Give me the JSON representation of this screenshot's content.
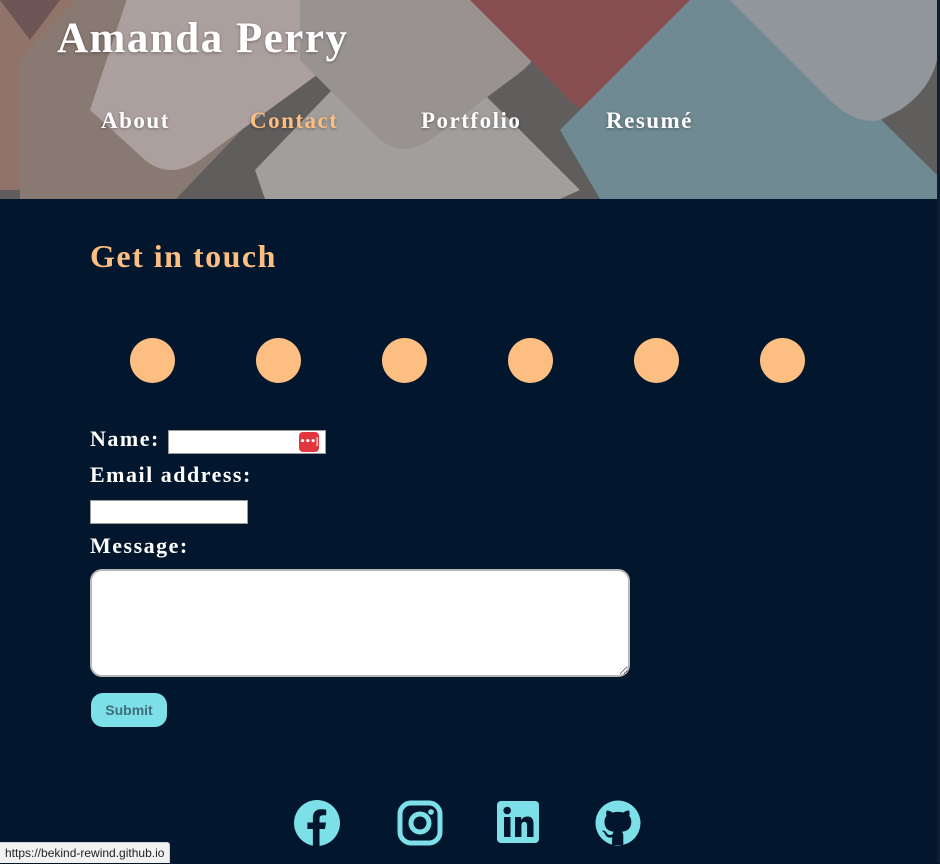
{
  "header": {
    "site_title": "Amanda Perry",
    "nav": [
      {
        "label": "About",
        "active": false
      },
      {
        "label": "Contact",
        "active": true
      },
      {
        "label": "Portfolio",
        "active": false
      },
      {
        "label": "Resumé",
        "active": false
      }
    ]
  },
  "contact": {
    "heading": "Get in touch",
    "dots_count": 6,
    "form": {
      "name_label": "Name:",
      "name_value": "",
      "email_label": "Email address:",
      "email_value": "",
      "message_label": "Message:",
      "message_value": "",
      "submit_label": "Submit",
      "password_manager_icon": "•••|"
    }
  },
  "social": [
    {
      "name": "facebook-icon"
    },
    {
      "name": "instagram-icon"
    },
    {
      "name": "linkedin-icon"
    },
    {
      "name": "github-icon"
    }
  ],
  "status_bar": {
    "url": "https://bekind-rewind.github.io"
  },
  "colors": {
    "background": "#02162d",
    "accent": "#fdbe81",
    "button": "#7ddfe8",
    "icon": "#7ddfe8",
    "text": "#ffffff"
  }
}
